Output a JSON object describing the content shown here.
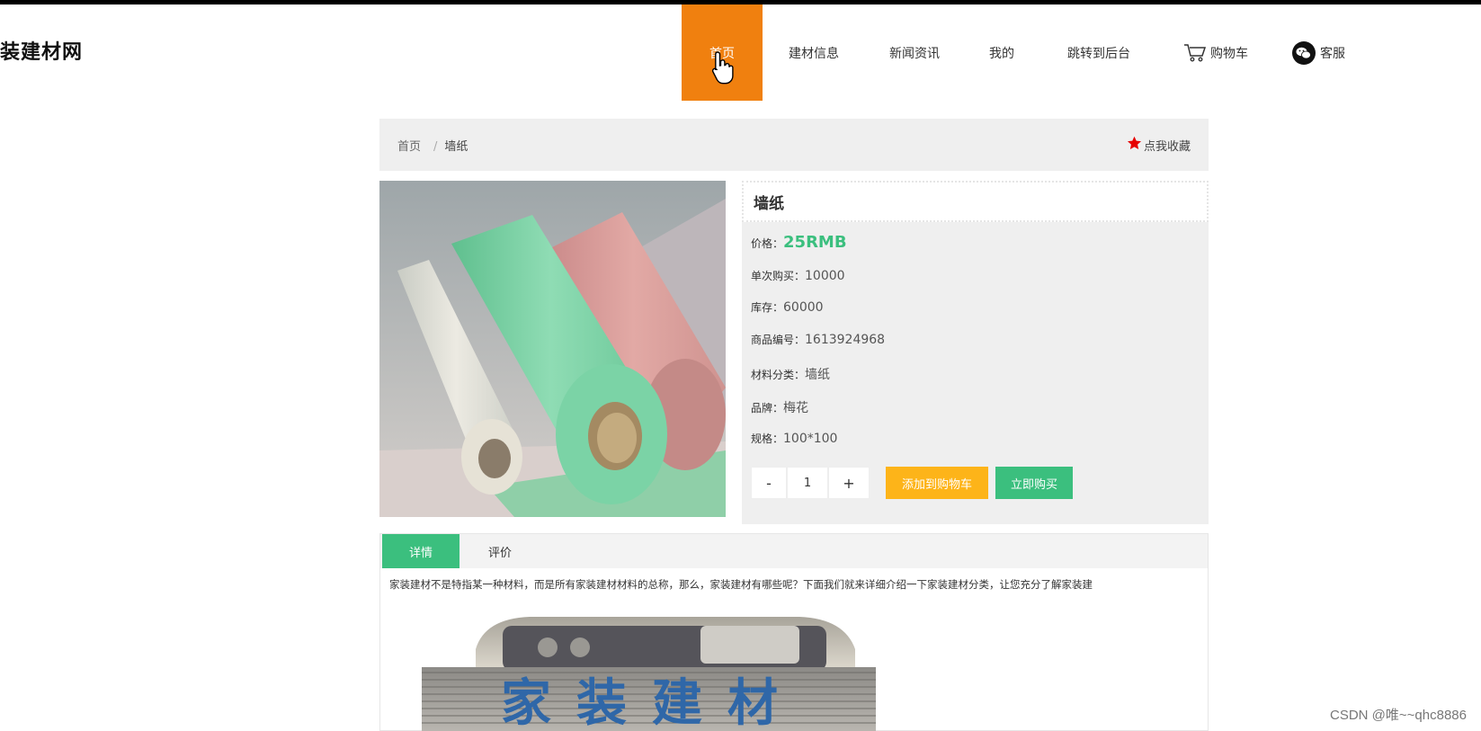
{
  "site": {
    "logo": "装建材网"
  },
  "nav": [
    {
      "label": "首页",
      "active": true,
      "icon": ""
    },
    {
      "label": "建材信息",
      "active": false,
      "icon": ""
    },
    {
      "label": "新闻资讯",
      "active": false,
      "icon": ""
    },
    {
      "label": "我的",
      "active": false,
      "icon": ""
    },
    {
      "label": "跳转到后台",
      "active": false,
      "icon": ""
    },
    {
      "label": "购物车",
      "active": false,
      "icon": "cart-icon"
    },
    {
      "label": "客服",
      "active": false,
      "icon": "wechat-icon"
    }
  ],
  "breadcrumb": {
    "home": "首页",
    "separator": "/",
    "current": "墙纸"
  },
  "favorite": {
    "label": "点我收藏",
    "icon": "star-icon",
    "color": "#e60000"
  },
  "product": {
    "title": "墙纸",
    "price_label": "价格：",
    "price_value": "25RMB",
    "single_label": "单次购买：",
    "single_value": "10000",
    "stock_label": "库存：",
    "stock_value": "60000",
    "code_label": "商品编号：",
    "code_value": "1613924968",
    "category_label": "材料分类：",
    "category_value": "墙纸",
    "brand_label": "品牌：",
    "brand_value": "梅花",
    "spec_label": "规格：",
    "spec_value": "100*100"
  },
  "quantity": {
    "minus": "-",
    "value": "1",
    "plus": "+"
  },
  "actions": {
    "add_to_cart": "添加到购物车",
    "buy_now": "立即购买"
  },
  "tabs": [
    {
      "label": "详情",
      "active": true
    },
    {
      "label": "评价",
      "active": false
    }
  ],
  "description": "家装建材不是特指某一种材料，而是所有家装建材材料的总称，那么，家装建材有哪些呢？下面我们就来详细介绍一下家装建材分类，让您充分了解家装建",
  "banner": {
    "text": "家装建材"
  },
  "watermark": "CSDN @唯~~qhc8886",
  "colors": {
    "accent_orange": "#f0800f",
    "accent_green": "#3bbf7e",
    "button_yellow": "#fdb419"
  }
}
